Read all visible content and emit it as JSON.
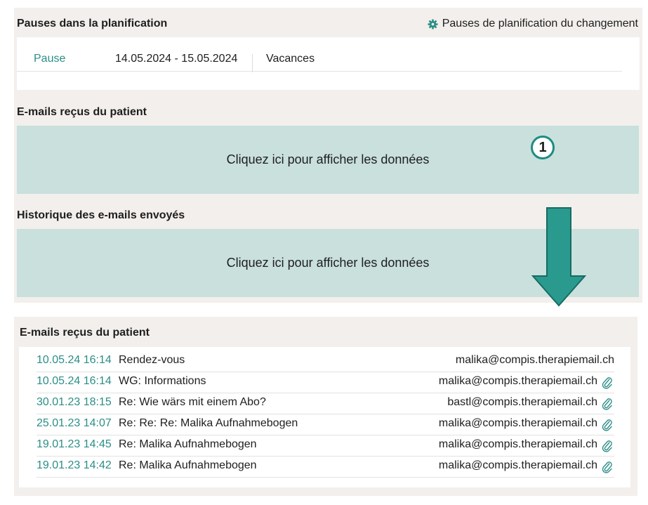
{
  "schedule_pauses": {
    "title": "Pauses dans la planification",
    "change_link": "Pauses de planification du changement",
    "change_icon": "gear-icon",
    "rows": [
      {
        "type": "Pause",
        "dates": "14.05.2024 - 15.05.2024",
        "reason": "Vacances"
      }
    ]
  },
  "received_emails_collapsed": {
    "title": "E-mails reçus du patient",
    "placeholder": "Cliquez ici pour afficher les données",
    "step_badge": "1"
  },
  "sent_history": {
    "title": "Historique des e-mails envoyés",
    "placeholder": "Cliquez ici pour afficher les données"
  },
  "received_emails_expanded": {
    "title": "E-mails reçus du patient",
    "attachment_icon": "paperclip-icon",
    "rows": [
      {
        "date": "10.05.24 16:14",
        "subject": "Rendez-vous",
        "from": "malika@compis.therapiemail.ch",
        "attachment": false
      },
      {
        "date": "10.05.24 16:14",
        "subject": "WG: Informations",
        "from": "malika@compis.therapiemail.ch",
        "attachment": true
      },
      {
        "date": "30.01.23 18:15",
        "subject": "Re: Wie wärs mit einem Abo?",
        "from": "bastl@compis.therapiemail.ch",
        "attachment": true
      },
      {
        "date": "25.01.23 14:07",
        "subject": "Re: Re: Re: Malika Aufnahmebogen",
        "from": "malika@compis.therapiemail.ch",
        "attachment": true
      },
      {
        "date": "19.01.23 14:45",
        "subject": "Re: Malika Aufnahmebogen",
        "from": "malika@compis.therapiemail.ch",
        "attachment": true
      },
      {
        "date": "19.01.23 14:42",
        "subject": "Re: Malika Aufnahmebogen",
        "from": "malika@compis.therapiemail.ch",
        "attachment": true
      }
    ]
  },
  "colors": {
    "accent": "#2b8e87",
    "panel_bg": "#f2efec",
    "data_box_bg": "#c9e0dd",
    "arrow": "#2a9a8f"
  }
}
